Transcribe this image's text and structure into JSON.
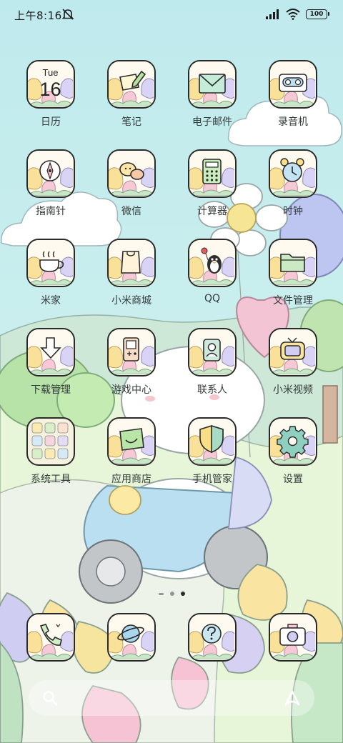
{
  "status_bar": {
    "time": "上午8:16",
    "battery": "100",
    "icons": [
      "mute-icon",
      "signal-icon",
      "wifi-icon",
      "battery-icon"
    ]
  },
  "apps": [
    {
      "id": "calendar",
      "label": "日历",
      "icon": "calendar-icon",
      "weekday": "Tue",
      "day": "16"
    },
    {
      "id": "notes",
      "label": "笔记",
      "icon": "notes-icon"
    },
    {
      "id": "email",
      "label": "电子邮件",
      "icon": "email-icon"
    },
    {
      "id": "recorder",
      "label": "录音机",
      "icon": "recorder-icon"
    },
    {
      "id": "compass",
      "label": "指南针",
      "icon": "compass-icon"
    },
    {
      "id": "wechat",
      "label": "微信",
      "icon": "wechat-icon"
    },
    {
      "id": "calculator",
      "label": "计算器",
      "icon": "calculator-icon"
    },
    {
      "id": "clock",
      "label": "时钟",
      "icon": "alarm-clock-icon"
    },
    {
      "id": "mijia",
      "label": "米家",
      "icon": "teacup-icon"
    },
    {
      "id": "mi-store",
      "label": "小米商城",
      "icon": "shopping-bag-icon"
    },
    {
      "id": "qq",
      "label": "QQ",
      "icon": "qq-penguin-icon"
    },
    {
      "id": "file-manager",
      "label": "文件管理",
      "icon": "folder-icon"
    },
    {
      "id": "downloads",
      "label": "下载管理",
      "icon": "download-arrow-icon"
    },
    {
      "id": "game-center",
      "label": "游戏中心",
      "icon": "game-console-icon"
    },
    {
      "id": "contacts",
      "label": "联系人",
      "icon": "contact-card-icon"
    },
    {
      "id": "mi-video",
      "label": "小米视频",
      "icon": "tv-icon"
    },
    {
      "id": "system-tools",
      "label": "系统工具",
      "icon": "folder-grid-icon"
    },
    {
      "id": "app-store",
      "label": "应用商店",
      "icon": "store-bag-icon"
    },
    {
      "id": "security",
      "label": "手机管家",
      "icon": "shield-icon"
    },
    {
      "id": "settings",
      "label": "设置",
      "icon": "gear-icon"
    }
  ],
  "page_indicator": {
    "pages": 3,
    "active": 3
  },
  "dock": [
    {
      "id": "phone",
      "icon": "phone-icon"
    },
    {
      "id": "browser",
      "icon": "planet-icon"
    },
    {
      "id": "help",
      "icon": "question-bubble-icon"
    },
    {
      "id": "camera",
      "icon": "camera-icon"
    }
  ],
  "search_bar": {
    "left_icon": "search-icon",
    "right_icon": "assistant-icon"
  },
  "colors": {
    "sky": "#bfe9ec",
    "grass": "#dff2dc",
    "outline": "#2a2a2a",
    "label": "#333a3a"
  }
}
